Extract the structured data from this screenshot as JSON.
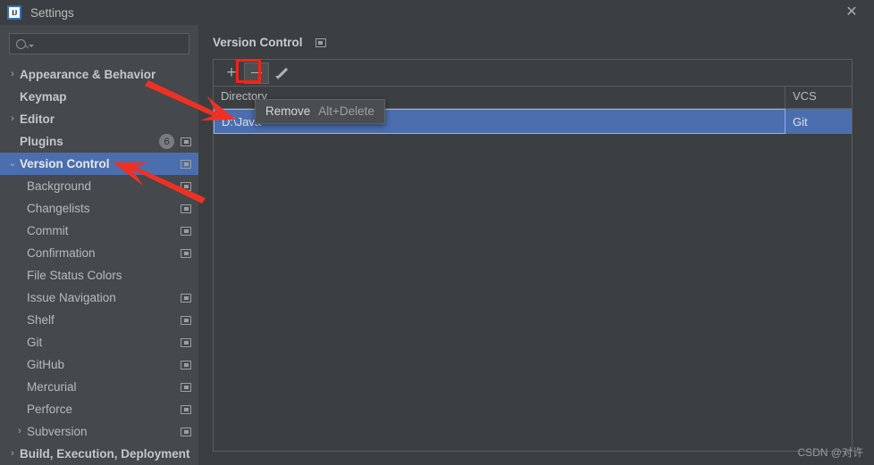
{
  "window": {
    "title": "Settings",
    "logo_text": "IJ",
    "logo_icon": "intellij-idea-icon",
    "close_icon": "close-icon"
  },
  "search": {
    "value": "",
    "placeholder": "",
    "icon": "search-icon",
    "dropdown_icon": "chevron-down-icon"
  },
  "sidebar": {
    "items": [
      {
        "label": "Appearance & Behavior",
        "level": 0,
        "arrow": "collapsed",
        "bold": true,
        "badge": null,
        "scope_icon": false,
        "selected": false
      },
      {
        "label": "Keymap",
        "level": 0,
        "arrow": "none",
        "bold": true,
        "badge": null,
        "scope_icon": false,
        "selected": false
      },
      {
        "label": "Editor",
        "level": 0,
        "arrow": "collapsed",
        "bold": true,
        "badge": null,
        "scope_icon": false,
        "selected": false
      },
      {
        "label": "Plugins",
        "level": 0,
        "arrow": "none",
        "bold": true,
        "badge": "6",
        "scope_icon": true,
        "selected": false
      },
      {
        "label": "Version Control",
        "level": 0,
        "arrow": "expanded",
        "bold": true,
        "badge": null,
        "scope_icon": true,
        "selected": true
      },
      {
        "label": "Background",
        "level": 1,
        "arrow": "none",
        "bold": false,
        "badge": null,
        "scope_icon": true,
        "selected": false
      },
      {
        "label": "Changelists",
        "level": 1,
        "arrow": "none",
        "bold": false,
        "badge": null,
        "scope_icon": true,
        "selected": false
      },
      {
        "label": "Commit",
        "level": 1,
        "arrow": "none",
        "bold": false,
        "badge": null,
        "scope_icon": true,
        "selected": false
      },
      {
        "label": "Confirmation",
        "level": 1,
        "arrow": "none",
        "bold": false,
        "badge": null,
        "scope_icon": true,
        "selected": false
      },
      {
        "label": "File Status Colors",
        "level": 1,
        "arrow": "none",
        "bold": false,
        "badge": null,
        "scope_icon": false,
        "selected": false
      },
      {
        "label": "Issue Navigation",
        "level": 1,
        "arrow": "none",
        "bold": false,
        "badge": null,
        "scope_icon": true,
        "selected": false
      },
      {
        "label": "Shelf",
        "level": 1,
        "arrow": "none",
        "bold": false,
        "badge": null,
        "scope_icon": true,
        "selected": false
      },
      {
        "label": "Git",
        "level": 1,
        "arrow": "none",
        "bold": false,
        "badge": null,
        "scope_icon": true,
        "selected": false
      },
      {
        "label": "GitHub",
        "level": 1,
        "arrow": "none",
        "bold": false,
        "badge": null,
        "scope_icon": true,
        "selected": false
      },
      {
        "label": "Mercurial",
        "level": 1,
        "arrow": "none",
        "bold": false,
        "badge": null,
        "scope_icon": true,
        "selected": false
      },
      {
        "label": "Perforce",
        "level": 1,
        "arrow": "none",
        "bold": false,
        "badge": null,
        "scope_icon": true,
        "selected": false
      },
      {
        "label": "Subversion",
        "level": 1,
        "arrow": "collapsed",
        "bold": false,
        "badge": null,
        "scope_icon": true,
        "selected": false
      },
      {
        "label": "Build, Execution, Deployment",
        "level": 0,
        "arrow": "collapsed",
        "bold": true,
        "badge": null,
        "scope_icon": false,
        "selected": false
      }
    ]
  },
  "main": {
    "title": "Version Control",
    "scope_icon": "project-scope-icon",
    "toolbar": {
      "add_label": "+",
      "add_icon": "plus-icon",
      "remove_icon": "minus-icon",
      "edit_icon": "pencil-icon"
    },
    "table": {
      "columns": [
        "Directory",
        "VCS"
      ],
      "rows": [
        {
          "directory": "D:\\Java",
          "vcs": "Git",
          "selected": true
        }
      ]
    }
  },
  "tooltip": {
    "label": "Remove",
    "shortcut": "Alt+Delete"
  },
  "annotations": {
    "highlight_color": "#f52318",
    "arrow_color": "#ef3124"
  },
  "watermark": {
    "text": "CSDN @对许"
  },
  "colors": {
    "titlebar_bg": "#3c3f41",
    "sidebar_bg": "#45484d",
    "panel_bg": "#3c3f41",
    "selection_blue": "#4b6eaf",
    "border": "#5a5d5e",
    "text": "#b6babd"
  }
}
